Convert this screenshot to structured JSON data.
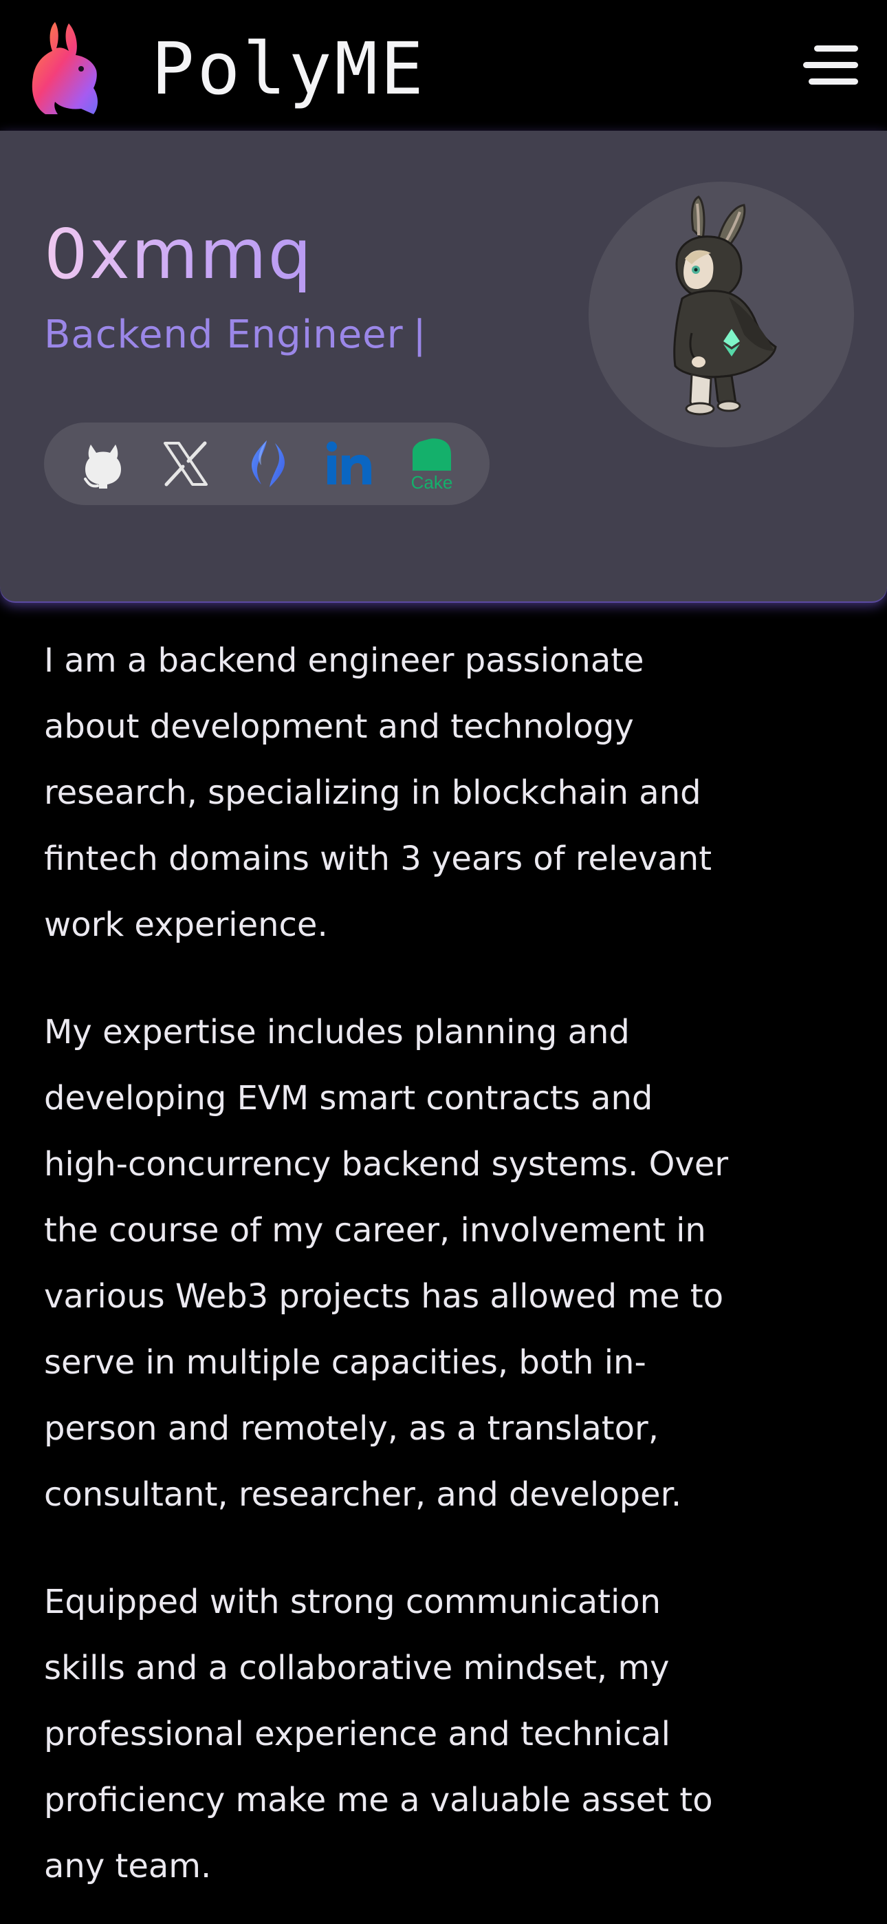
{
  "brand": {
    "name": "PolyME",
    "logo_icon": "bunny-logo-icon"
  },
  "header": {
    "menu_icon": "hamburger-menu-icon"
  },
  "profile": {
    "name": "0xmmq",
    "role": "Backend Engineer",
    "cursor": "|",
    "avatar_icon": "bunny-hoodie-avatar",
    "socials": [
      {
        "id": "github",
        "icon": "github-icon"
      },
      {
        "id": "x",
        "icon": "x-icon"
      },
      {
        "id": "ens",
        "icon": "ens-icon"
      },
      {
        "id": "linkedin",
        "icon": "linkedin-icon"
      },
      {
        "id": "cake",
        "icon": "cake-icon",
        "label": "Cake"
      }
    ]
  },
  "about": {
    "paragraphs": [
      "I am a backend engineer passionate about development and technology research, specializing in blockchain and fintech domains with 3 years of relevant work experience.",
      "My expertise includes planning and developing EVM smart contracts and high-concurrency backend systems. Over the course of my career, involvement in various Web3 projects has allowed me to serve in multiple capacities, both in-person and remotely, as a translator, consultant, researcher, and developer.",
      "Equipped with strong communication skills and a collaborative mindset, my professional experience and technical proficiency make me a valuable asset to any team."
    ]
  },
  "colors": {
    "background": "#000000",
    "card": "#42404e",
    "accent": "#9b87e8",
    "name_gradient_start": "#f0c9f0",
    "name_gradient_end": "#b89bf2",
    "text": "#ebe9f0"
  }
}
